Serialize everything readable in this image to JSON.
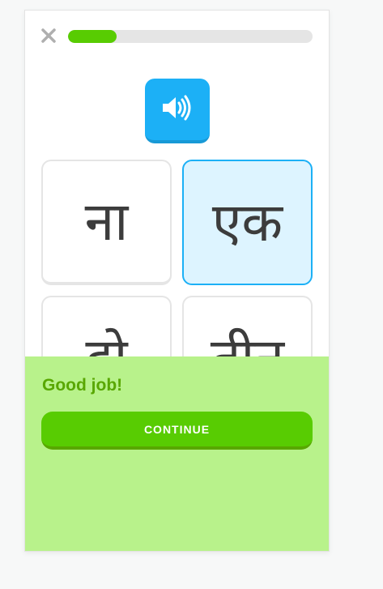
{
  "header": {
    "close_icon": "close-icon",
    "progress_fraction": 0.2
  },
  "audio": {
    "icon": "speaker-icon"
  },
  "choices": [
    {
      "text": "ना",
      "selected": false
    },
    {
      "text": "एक",
      "selected": true
    },
    {
      "text": "दो",
      "selected": false
    },
    {
      "text": "तीन",
      "selected": false
    }
  ],
  "feedback": {
    "title": "Good job!",
    "continue_label": "CONTINUE"
  },
  "colors": {
    "accent_green": "#58cc02",
    "dark_green": "#58a700",
    "feedback_bg": "#b8f28b",
    "audio_blue": "#1cb0f6",
    "selected_bg": "#ddf4ff"
  }
}
